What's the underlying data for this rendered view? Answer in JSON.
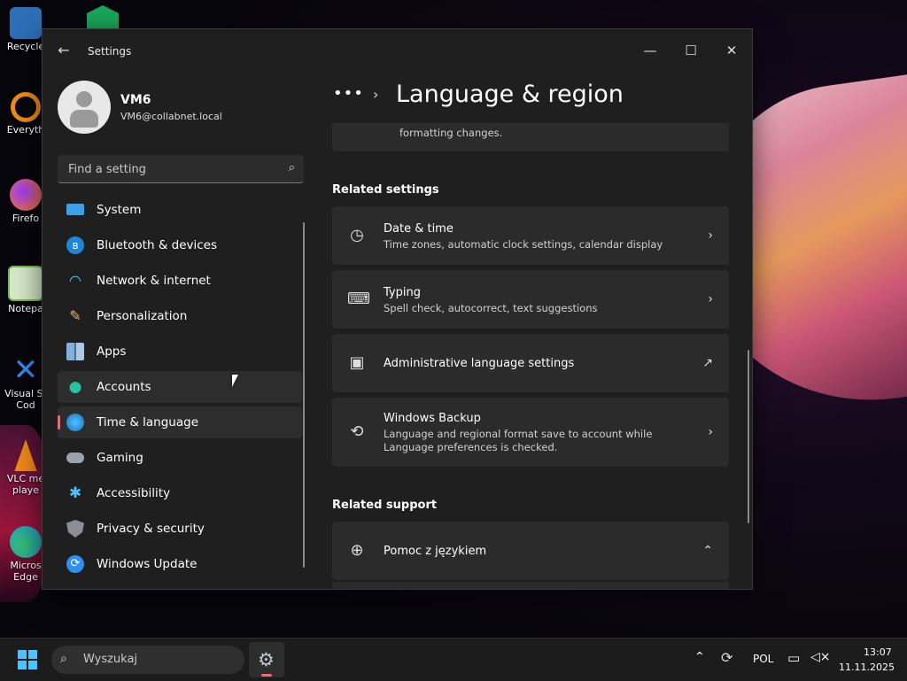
{
  "desktop": {
    "icons": [
      {
        "label": "Recycle",
        "color": "#3aa0e8"
      },
      {
        "label": "Everyth",
        "color": "#f08a1c"
      },
      {
        "label": "Firefo",
        "color": "#ff7a18"
      },
      {
        "label": "Notepa",
        "color": "#6fbf4a"
      },
      {
        "label": "Visual St\nCod",
        "color": "#2d8ff0"
      },
      {
        "label": "VLC me\nplaye",
        "color": "#f08a1c"
      },
      {
        "label": "Micros\nEdge",
        "color": "#1f9ad6"
      }
    ]
  },
  "window": {
    "title": "Settings",
    "back_icon": "arrow-left-icon",
    "controls": {
      "minimize": "—",
      "maximize": "☐",
      "close": "✕"
    }
  },
  "profile": {
    "name": "VM6",
    "email": "VM6@collabnet.local"
  },
  "search": {
    "placeholder": "Find a setting"
  },
  "nav": {
    "items": [
      {
        "label": "System",
        "icon": "monitor-icon"
      },
      {
        "label": "Bluetooth & devices",
        "icon": "bluetooth-icon"
      },
      {
        "label": "Network & internet",
        "icon": "wifi-icon"
      },
      {
        "label": "Personalization",
        "icon": "brush-icon"
      },
      {
        "label": "Apps",
        "icon": "apps-icon"
      },
      {
        "label": "Accounts",
        "icon": "person-icon"
      },
      {
        "label": "Time & language",
        "icon": "globe-clock-icon"
      },
      {
        "label": "Gaming",
        "icon": "gamepad-icon"
      },
      {
        "label": "Accessibility",
        "icon": "accessibility-icon"
      },
      {
        "label": "Privacy & security",
        "icon": "shield-icon"
      },
      {
        "label": "Windows Update",
        "icon": "update-icon"
      }
    ],
    "selected": "Time & language",
    "hovered": "Accounts"
  },
  "main": {
    "breadcrumb_dots": "•••",
    "title": "Language & region",
    "partial_card_text": "formatting changes.",
    "related_settings_heading": "Related settings",
    "related_settings": [
      {
        "title": "Date & time",
        "desc": "Time zones, automatic clock settings, calendar display",
        "icon": "date-time-icon",
        "action": "chevron-right-icon"
      },
      {
        "title": "Typing",
        "desc": "Spell check, autocorrect, text suggestions",
        "icon": "keyboard-icon",
        "action": "chevron-right-icon"
      },
      {
        "title": "Administrative language settings",
        "desc": "",
        "icon": "admin-language-icon",
        "action": "external-link-icon"
      },
      {
        "title": "Windows Backup",
        "desc": "Language and regional format save to account while Language preferences is checked.",
        "icon": "backup-icon",
        "action": "chevron-right-icon"
      }
    ],
    "related_support_heading": "Related support",
    "support_item": {
      "title": "Pomoc z językiem",
      "icon": "globe-icon",
      "action": "chevron-up-icon"
    }
  },
  "taskbar": {
    "search_placeholder": "Wyszukaj",
    "language": "POL",
    "time": "13:07",
    "date": "11.11.2025",
    "accent": "#4cc2ff"
  }
}
